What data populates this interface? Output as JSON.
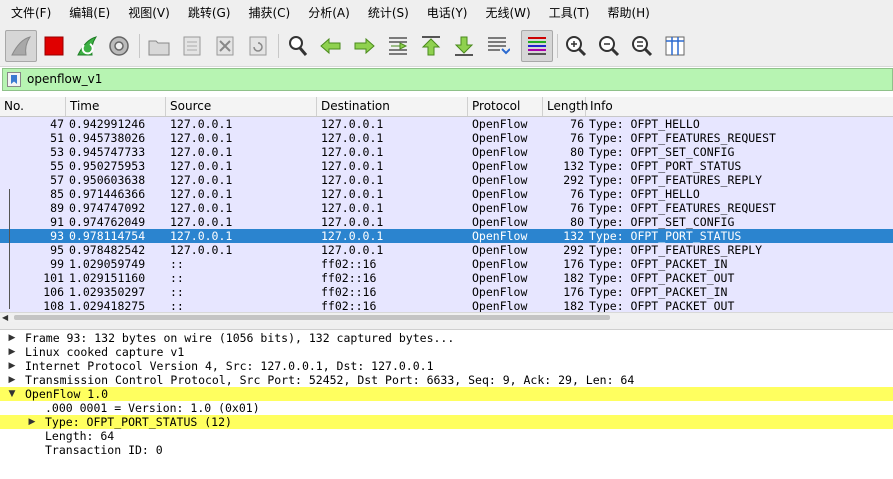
{
  "menubar": {
    "items": [
      "文件(F)",
      "编辑(E)",
      "视图(V)",
      "跳转(G)",
      "捕获(C)",
      "分析(A)",
      "统计(S)",
      "电话(Y)",
      "无线(W)",
      "工具(T)",
      "帮助(H)"
    ]
  },
  "toolbar": {
    "icons": [
      "shark-fin-start-icon",
      "stop-capture-icon",
      "restart-capture-icon",
      "capture-options-icon",
      "open-file-icon",
      "save-file-icon",
      "close-file-icon",
      "reload-file-icon",
      "find-packet-icon",
      "go-back-icon",
      "go-forward-icon",
      "go-to-packet-icon",
      "go-first-icon",
      "go-last-icon",
      "autoscroll-icon",
      "colorize-icon",
      "zoom-in-icon",
      "zoom-out-icon",
      "zoom-normal-icon",
      "resize-columns-icon"
    ]
  },
  "filter": {
    "value": "openflow_v1",
    "bg_color": "#b7f4b2"
  },
  "packet_list": {
    "columns": [
      "No.",
      "Time",
      "Source",
      "Destination",
      "Protocol",
      "Length",
      "Info"
    ],
    "rows": [
      {
        "no": "47",
        "time": "0.942991246",
        "source": "127.0.0.1",
        "destination": "127.0.0.1",
        "protocol": "OpenFlow",
        "length": "76",
        "info": "Type: OFPT_HELLO"
      },
      {
        "no": "51",
        "time": "0.945738026",
        "source": "127.0.0.1",
        "destination": "127.0.0.1",
        "protocol": "OpenFlow",
        "length": "76",
        "info": "Type: OFPT_FEATURES_REQUEST"
      },
      {
        "no": "53",
        "time": "0.945747733",
        "source": "127.0.0.1",
        "destination": "127.0.0.1",
        "protocol": "OpenFlow",
        "length": "80",
        "info": "Type: OFPT_SET_CONFIG"
      },
      {
        "no": "55",
        "time": "0.950275953",
        "source": "127.0.0.1",
        "destination": "127.0.0.1",
        "protocol": "OpenFlow",
        "length": "132",
        "info": "Type: OFPT_PORT_STATUS"
      },
      {
        "no": "57",
        "time": "0.950603638",
        "source": "127.0.0.1",
        "destination": "127.0.0.1",
        "protocol": "OpenFlow",
        "length": "292",
        "info": "Type: OFPT_FEATURES_REPLY"
      },
      {
        "no": "85",
        "time": "0.971446366",
        "source": "127.0.0.1",
        "destination": "127.0.0.1",
        "protocol": "OpenFlow",
        "length": "76",
        "info": "Type: OFPT_HELLO"
      },
      {
        "no": "89",
        "time": "0.974747092",
        "source": "127.0.0.1",
        "destination": "127.0.0.1",
        "protocol": "OpenFlow",
        "length": "76",
        "info": "Type: OFPT_FEATURES_REQUEST"
      },
      {
        "no": "91",
        "time": "0.974762049",
        "source": "127.0.0.1",
        "destination": "127.0.0.1",
        "protocol": "OpenFlow",
        "length": "80",
        "info": "Type: OFPT_SET_CONFIG"
      },
      {
        "no": "93",
        "time": "0.978114754",
        "source": "127.0.0.1",
        "destination": "127.0.0.1",
        "protocol": "OpenFlow",
        "length": "132",
        "info": "Type: OFPT_PORT_STATUS",
        "selected": true
      },
      {
        "no": "95",
        "time": "0.978482542",
        "source": "127.0.0.1",
        "destination": "127.0.0.1",
        "protocol": "OpenFlow",
        "length": "292",
        "info": "Type: OFPT_FEATURES_REPLY"
      },
      {
        "no": "99",
        "time": "1.029059749",
        "source": "::",
        "destination": "ff02::16",
        "protocol": "OpenFlow",
        "length": "176",
        "info": "Type: OFPT_PACKET_IN"
      },
      {
        "no": "101",
        "time": "1.029151160",
        "source": "::",
        "destination": "ff02::16",
        "protocol": "OpenFlow",
        "length": "182",
        "info": "Type: OFPT_PACKET_OUT"
      },
      {
        "no": "106",
        "time": "1.029350297",
        "source": "::",
        "destination": "ff02::16",
        "protocol": "OpenFlow",
        "length": "176",
        "info": "Type: OFPT_PACKET_IN"
      },
      {
        "no": "108",
        "time": "1.029418275",
        "source": "::",
        "destination": "ff02::16",
        "protocol": "OpenFlow",
        "length": "182",
        "info": "Type: OFPT_PACKET_OUT"
      }
    ],
    "row_color": "#e7e6ff",
    "selected_color": "#2b84cf"
  },
  "details": {
    "lines": [
      {
        "text": "Frame 93: 132 bytes on wire (1056 bits), 132 captured bytes... ",
        "expander": "collapsed",
        "level": 0
      },
      {
        "text": "Linux cooked capture v1",
        "expander": "collapsed",
        "level": 0
      },
      {
        "text": "Internet Protocol Version 4, Src: 127.0.0.1, Dst: 127.0.0.1",
        "expander": "collapsed",
        "level": 0
      },
      {
        "text": "Transmission Control Protocol, Src Port: 52452, Dst Port: 6633, Seq: 9, Ack: 29, Len: 64",
        "expander": "collapsed",
        "level": 0
      },
      {
        "text": "OpenFlow 1.0",
        "expander": "expanded",
        "level": 0,
        "highlight": true
      },
      {
        "text": ".000 0001 = Version: 1.0 (0x01)",
        "expander": "none",
        "level": 1
      },
      {
        "text": "Type: OFPT_PORT_STATUS (12)",
        "expander": "collapsed",
        "level": 1,
        "highlight": true
      },
      {
        "text": "Length: 64",
        "expander": "none",
        "level": 1
      },
      {
        "text": "Transaction ID: 0",
        "expander": "none",
        "level": 1
      }
    ],
    "highlight_color": "#ffff5f"
  }
}
